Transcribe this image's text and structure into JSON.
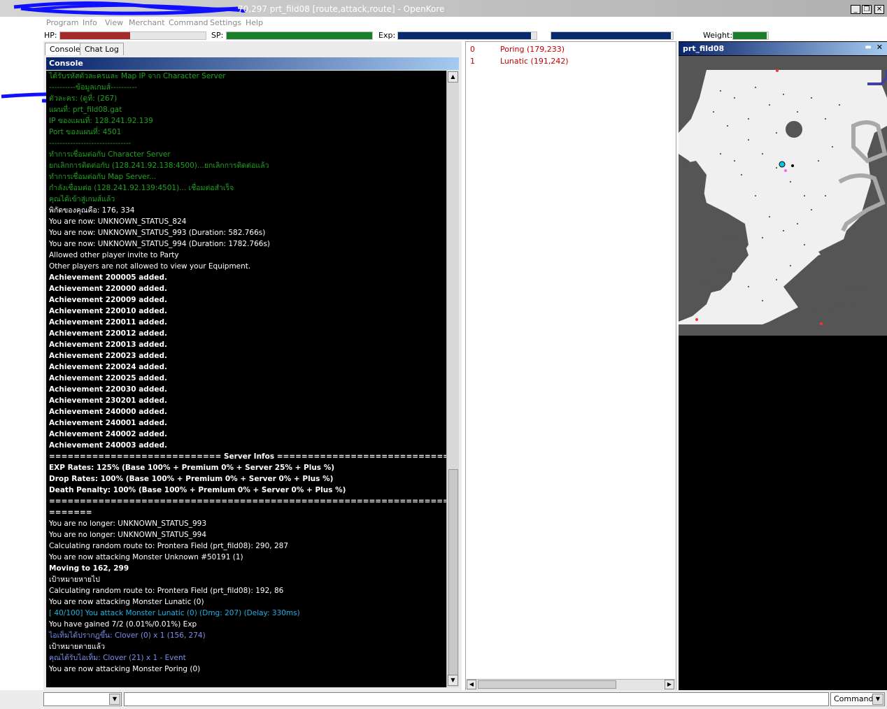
{
  "window": {
    "title": "70,297 prt_fild08 [route,attack,route] - OpenKore",
    "buttons": [
      "_",
      "❒",
      "✕"
    ]
  },
  "menu": [
    "Program",
    "Info",
    "View",
    "Merchant",
    "Command",
    "Settings",
    "Help"
  ],
  "status": {
    "hp_label": "HP:",
    "sp_label": "SP:",
    "exp_label": "Exp:",
    "weight_label": "Weight:",
    "hp_fill": 0.48,
    "sp_fill": 1.0,
    "exp_base_fill": 0.96,
    "exp_job_fill": 0.98,
    "weight_fill": 0.95,
    "colors": {
      "hp": "#a52a2a",
      "sp": "#1a7f2a",
      "exp": "#0a2a6e",
      "weight": "#1a7f2a"
    }
  },
  "tabs": {
    "console": "Console",
    "chatlog": "Chat Log"
  },
  "console": {
    "header": "Console",
    "lines": [
      {
        "text": "ได้รับรหัสตัวละครและ Map IP จาก Character Server",
        "style": "green"
      },
      {
        "text": "----------ข้อมูลเกมส์----------",
        "style": "green"
      },
      {
        "text": "ตัวละคร: (ดูที่:   (267)",
        "style": "green"
      },
      {
        "text": "แผนที่: prt_fild08.gat",
        "style": "green"
      },
      {
        "text": "IP ของแผนที่: 128.241.92.139",
        "style": "green"
      },
      {
        "text": "Port ของแผนที่: 4501",
        "style": "green"
      },
      {
        "text": "-------------------------------",
        "style": "green"
      },
      {
        "text": "ทำการเชื่อมต่อกับ Character Server",
        "style": "green"
      },
      {
        "text": "ยกเลิกการติดต่อกับ (128.241.92.138:4500)...ยกเลิกการติดต่อแล้ว",
        "style": "green"
      },
      {
        "text": "ทำการเชื่อมต่อกับ Map Server...",
        "style": "green"
      },
      {
        "text": "กำลังเชื่อมต่อ (128.241.92.139:4501)... เชื่อมต่อสำเร็จ",
        "style": "green"
      },
      {
        "text": "คุณได้เข้าสู่เกมส์แล้ว",
        "style": "green"
      },
      {
        "text": "พิกัดของคุณคือ: 176, 334",
        "style": "white"
      },
      {
        "text": "You are now: UNKNOWN_STATUS_824",
        "style": "white"
      },
      {
        "text": "You are now: UNKNOWN_STATUS_993 (Duration: 582.766s)",
        "style": "white"
      },
      {
        "text": "You are now: UNKNOWN_STATUS_994 (Duration: 1782.766s)",
        "style": "white"
      },
      {
        "text": "Allowed other player invite to Party",
        "style": "white"
      },
      {
        "text": "Other players are not allowed to view your Equipment.",
        "style": "white"
      },
      {
        "text": "Achievement 200005 added.",
        "style": "bold"
      },
      {
        "text": "Achievement 220000 added.",
        "style": "bold"
      },
      {
        "text": "Achievement 220009 added.",
        "style": "bold"
      },
      {
        "text": "Achievement 220010 added.",
        "style": "bold"
      },
      {
        "text": "Achievement 220011 added.",
        "style": "bold"
      },
      {
        "text": "Achievement 220012 added.",
        "style": "bold"
      },
      {
        "text": "Achievement 220013 added.",
        "style": "bold"
      },
      {
        "text": "Achievement 220023 added.",
        "style": "bold"
      },
      {
        "text": "Achievement 220024 added.",
        "style": "bold"
      },
      {
        "text": "Achievement 220025 added.",
        "style": "bold"
      },
      {
        "text": "Achievement 220030 added.",
        "style": "bold"
      },
      {
        "text": "Achievement 230201 added.",
        "style": "bold"
      },
      {
        "text": "Achievement 240000 added.",
        "style": "bold"
      },
      {
        "text": "Achievement 240001 added.",
        "style": "bold"
      },
      {
        "text": "Achievement 240002 added.",
        "style": "bold"
      },
      {
        "text": "Achievement 240003 added.",
        "style": "bold"
      },
      {
        "text": "============================ Server Infos ============================",
        "style": "bold"
      },
      {
        "text": "EXP Rates: 125% (Base 100% + Premium 0% + Server 25% + Plus %)",
        "style": "bold"
      },
      {
        "text": "Drop Rates: 100% (Base 100% + Premium 0% + Server 0% + Plus %)",
        "style": "bold"
      },
      {
        "text": "Death Penalty: 100% (Base 100% + Premium 0% + Server 0% + Plus %)",
        "style": "bold"
      },
      {
        "text": "=====================================================================",
        "style": "bold"
      },
      {
        "text": "=======",
        "style": "bold"
      },
      {
        "text": "You are no longer: UNKNOWN_STATUS_993",
        "style": "white"
      },
      {
        "text": "You are no longer: UNKNOWN_STATUS_994",
        "style": "white"
      },
      {
        "text": "Calculating random route to: Prontera Field (prt_fild08): 290, 287",
        "style": "white"
      },
      {
        "text": "You are now attacking Monster Unknown #50191 (1)",
        "style": "white"
      },
      {
        "text": "Moving to 162, 299",
        "style": "bold"
      },
      {
        "text": "เป้าหมายหายไป",
        "style": "white"
      },
      {
        "text": "Calculating random route to: Prontera Field (prt_fild08): 192, 86",
        "style": "white"
      },
      {
        "text": "You are now attacking Monster Lunatic (0)",
        "style": "white"
      },
      {
        "text": "[ 40/100] You attack Monster Lunatic (0) (Dmg: 207) (Delay: 330ms)",
        "style": "cyan"
      },
      {
        "text": "You have gained 7/2 (0.01%/0.01%) Exp",
        "style": "white"
      },
      {
        "text": "ไอเท็มได้ปรากฎขึ้น: Clover (0) x 1 (156, 274)",
        "style": "blue"
      },
      {
        "text": "เป้าหมายตายแล้ว",
        "style": "white"
      },
      {
        "text": "คุณได้รับไอเท็ม: Clover (21) x 1 - Event",
        "style": "blue"
      },
      {
        "text": "You are now attacking Monster Poring (0)",
        "style": "white"
      }
    ]
  },
  "monsters": [
    {
      "index": "0",
      "name": "Poring (179,233)"
    },
    {
      "index": "1",
      "name": "Lunatic (191,242)"
    }
  ],
  "map": {
    "title": "prt_fild08"
  },
  "bottom": {
    "command_label": "Command"
  }
}
